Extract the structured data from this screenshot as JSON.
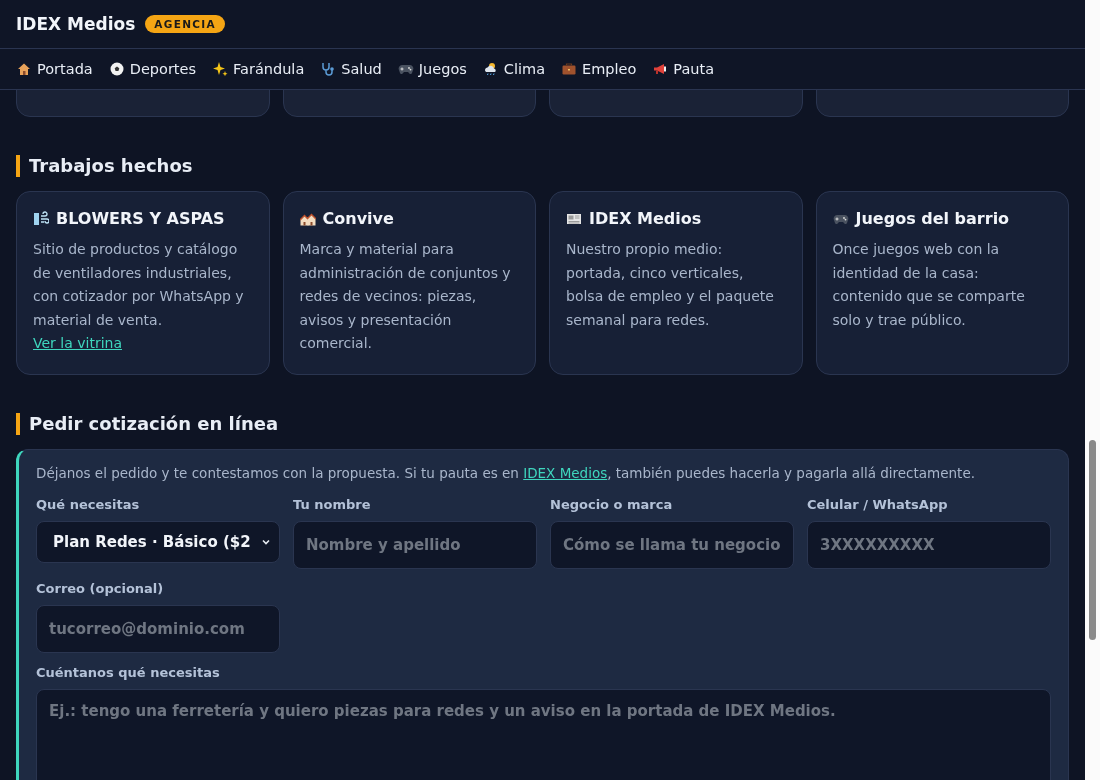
{
  "header": {
    "brand": "IDEX Medios",
    "badge": "AGENCIA"
  },
  "nav": [
    {
      "label": "Portada"
    },
    {
      "label": "Deportes"
    },
    {
      "label": "Farándula"
    },
    {
      "label": "Salud"
    },
    {
      "label": "Juegos"
    },
    {
      "label": "Clima"
    },
    {
      "label": "Empleo"
    },
    {
      "label": "Pauta"
    }
  ],
  "works": {
    "title": "Trabajos hechos",
    "cards": [
      {
        "title": "BLOWERS Y ASPAS",
        "text": "Sitio de productos y catálogo de ventiladores industriales, con cotizador por WhatsApp y material de venta.",
        "link": "Ver la vitrina"
      },
      {
        "title": "Convive",
        "text": "Marca y material para administración de conjuntos y redes de vecinos: piezas, avisos y presentación comercial."
      },
      {
        "title": "IDEX Medios",
        "text": "Nuestro propio medio: portada, cinco verticales, bolsa de empleo y el paquete semanal para redes."
      },
      {
        "title": "Juegos del barrio",
        "text": "Once juegos web con la identidad de la casa: contenido que se comparte solo y trae público."
      }
    ]
  },
  "quote": {
    "title": "Pedir cotización en línea",
    "intro_before": "Déjanos el pedido y te contestamos con la propuesta. Si tu pauta es en ",
    "intro_link": "IDEX Medios",
    "intro_after": ", también puedes hacerla y pagarla allá directamente.",
    "fields": [
      {
        "kind": "select",
        "label": "Qué necesitas",
        "value": "Plan Redes · Básico ($2"
      },
      {
        "kind": "input",
        "label": "Tu nombre",
        "placeholder": "Nombre y apellido"
      },
      {
        "kind": "input",
        "label": "Negocio o marca",
        "placeholder": "Cómo se llama tu negocio"
      },
      {
        "kind": "input",
        "label": "Celular / WhatsApp",
        "placeholder": "3XXXXXXXXX"
      },
      {
        "kind": "input",
        "label": "Correo (opcional)",
        "placeholder": "tucorreo@dominio.com"
      },
      {
        "kind": "textarea",
        "label": "Cuéntanos qué necesitas",
        "placeholder": "Ej.: tengo una ferretería y quiero piezas para redes y un aviso en la portada de IDEX Medios."
      }
    ]
  }
}
